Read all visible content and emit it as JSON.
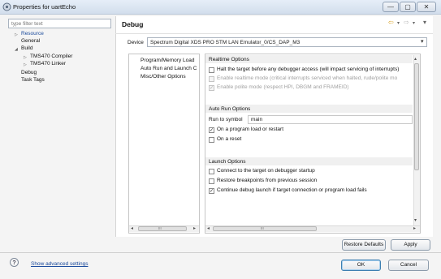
{
  "window": {
    "title": "Properties for uartEcho",
    "minimize_glyph": "—",
    "maximize_glyph": "▢",
    "close_glyph": "✕"
  },
  "sidebar": {
    "filter_placeholder": "type filter text",
    "items": [
      {
        "label": "Resource",
        "arrow": "▷"
      },
      {
        "label": "General"
      },
      {
        "label": "Build",
        "arrow": "◢"
      },
      {
        "label": "TMS470 Compiler",
        "arrow": "▷"
      },
      {
        "label": "TMS470 Linker",
        "arrow": "▷"
      },
      {
        "label": "Debug"
      },
      {
        "label": "Task Tags"
      }
    ]
  },
  "header": {
    "title": "Debug",
    "back_icon": "⇦",
    "forward_icon": "⇨",
    "dropdown_icon": "▾"
  },
  "device": {
    "label": "Device",
    "value": "Spectrum Digital XDS PRO STM LAN Emulator_0/CS_DAP_M3",
    "arrow": "▾"
  },
  "categories": {
    "items": [
      "Program/Memory Load",
      "Auto Run and Launch C",
      "Misc/Other Options"
    ],
    "scroll_left": "◂",
    "scroll_grip": "III",
    "scroll_right": "▸"
  },
  "realtime": {
    "title": "Realtime Options",
    "halt_label": "Halt the target before any debugger access (will impact servicing of interrupts)",
    "halt_checked": false,
    "realtime_label": "Enable realtime mode (critical interrupts serviced when halted, rude/polite mo",
    "realtime_checked": false,
    "polite_label": "Enable polite mode (respect HPI, DBGM and FRAMEID)",
    "polite_checked": true
  },
  "autorun": {
    "title": "Auto Run Options",
    "run_label": "Run to symbol",
    "run_value": "main",
    "load_label": "On a program load or restart",
    "load_checked": true,
    "reset_label": "On a reset",
    "reset_checked": false
  },
  "launch": {
    "title": "Launch Options",
    "connect_label": "Connect to the target on debugger startup",
    "connect_checked": false,
    "restore_label": "Restore breakpoints from previous session",
    "restore_checked": false,
    "continue_label": "Continue debug launch if target connection or program load fails",
    "continue_checked": true
  },
  "content_scroll": {
    "up": "▴",
    "down": "▾",
    "left": "◂",
    "grip": "III",
    "right": "▸"
  },
  "buttons": {
    "restore_defaults": "Restore Defaults",
    "apply": "Apply",
    "ok": "OK",
    "cancel": "Cancel"
  },
  "footer": {
    "help_glyph": "?",
    "advanced_link": "Show advanced settings"
  },
  "check_glyph": "✓"
}
